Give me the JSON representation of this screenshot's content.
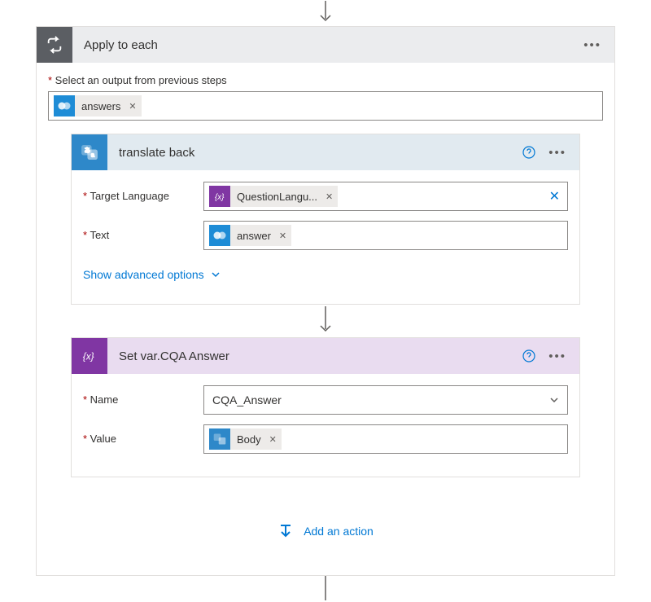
{
  "outer": {
    "title": "Apply to each",
    "select_label": "Select an output from previous steps",
    "output_token": "answers"
  },
  "translate": {
    "title": "translate back",
    "target_lang_label": "Target Language",
    "target_lang_token": "QuestionLangu...",
    "text_label": "Text",
    "text_token": "answer",
    "advanced": "Show advanced options"
  },
  "setvar": {
    "title": "Set var.CQA Answer",
    "name_label": "Name",
    "name_value": "CQA_Answer",
    "value_label": "Value",
    "value_token": "Body"
  },
  "add_action_label": "Add an action"
}
